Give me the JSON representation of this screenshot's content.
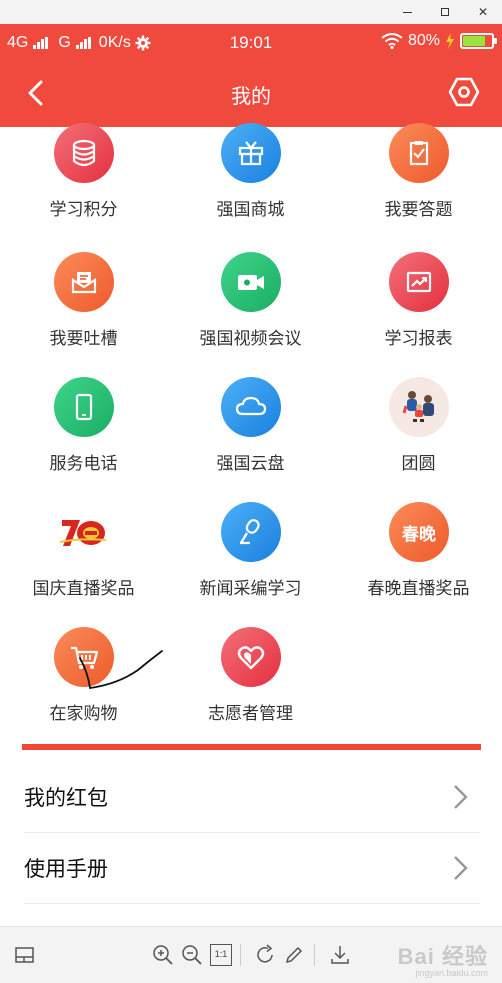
{
  "status_bar": {
    "network_1": "4G",
    "network_2": "G",
    "speed": "0K/s",
    "time": "19:01",
    "battery_pct": "80%",
    "battery_level": 0.8,
    "battery_color": "#9be33f"
  },
  "nav": {
    "title": "我的",
    "back_icon": "chevron-left-icon",
    "settings_icon": "hexagon-gear-icon"
  },
  "theme": {
    "accent": "#f04a3f",
    "divider": "#ef4438"
  },
  "grid_items": [
    {
      "label": "学习积分",
      "icon": "database-icon"
    },
    {
      "label": "强国商城",
      "icon": "gift-box-icon"
    },
    {
      "label": "我要答题",
      "icon": "clipboard-check-icon"
    },
    {
      "label": "我要吐槽",
      "icon": "mail-message-icon"
    },
    {
      "label": "强国视频会议",
      "icon": "video-camera-icon"
    },
    {
      "label": "学习报表",
      "icon": "trend-chart-icon"
    },
    {
      "label": "服务电话",
      "icon": "phone-icon"
    },
    {
      "label": "强国云盘",
      "icon": "cloud-icon"
    },
    {
      "label": "团圆",
      "icon": "family-reunion-icon"
    },
    {
      "label": "国庆直播奖品",
      "icon": "anniversary-70-icon"
    },
    {
      "label": "新闻采编学习",
      "icon": "microphone-icon"
    },
    {
      "label": "春晚直播奖品",
      "icon": "spring-gala-icon",
      "icon_text": "春晚"
    },
    {
      "label": "在家购物",
      "icon": "shopping-cart-icon"
    },
    {
      "label": "志愿者管理",
      "icon": "heart-icon"
    }
  ],
  "list_items": [
    {
      "label": "我的红包"
    },
    {
      "label": "使用手册"
    }
  ],
  "viewer_toolbar": {
    "icons": [
      "thumbnail-panel-icon",
      "zoom-in-icon",
      "zoom-out-icon",
      "actual-size-icon",
      "rotate-icon",
      "pen-icon",
      "download-icon"
    ],
    "actual_size_label": "1:1",
    "watermark": "Bai 经验",
    "watermark_sub": "jingyan.baidu.com"
  }
}
